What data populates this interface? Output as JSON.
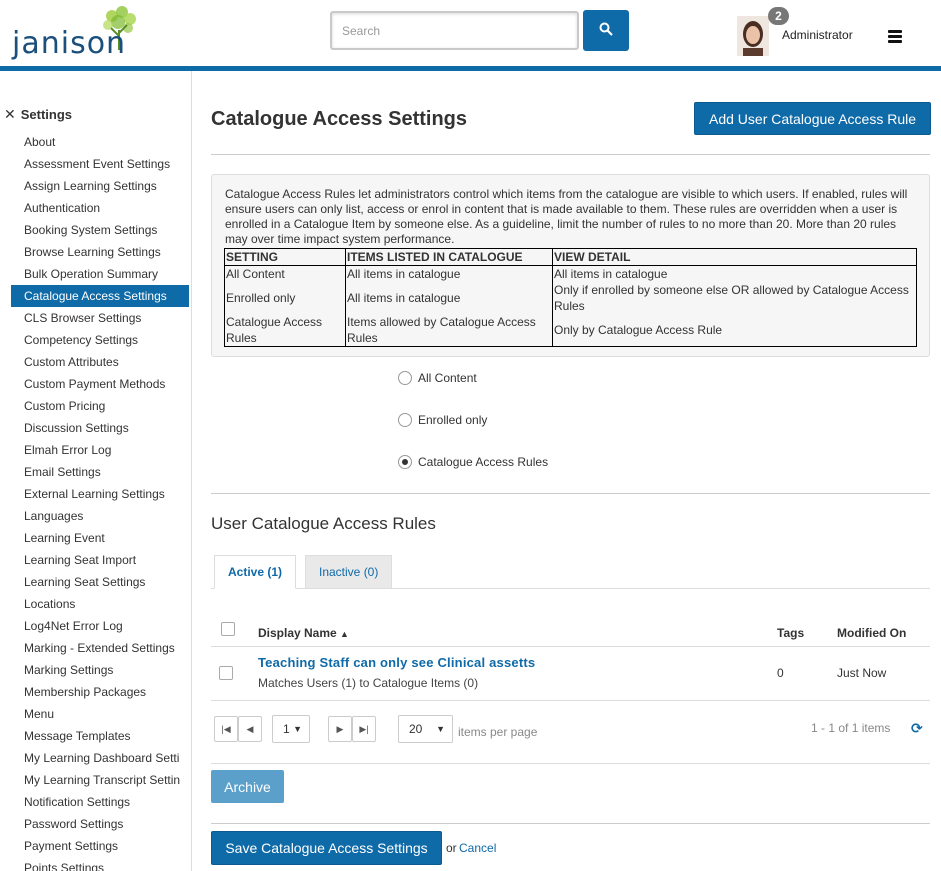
{
  "header": {
    "logo_text": "janison",
    "search_placeholder": "Search",
    "notification_count": "2",
    "user_name": "Administrator"
  },
  "colors": {
    "brand": "#0f6aa8",
    "archive": "#5b9fcb"
  },
  "sidebar": {
    "title": "Settings",
    "items": [
      "About",
      "Assessment Event Settings",
      "Assign Learning Settings",
      "Authentication",
      "Booking System Settings",
      "Browse Learning Settings",
      "Bulk Operation Summary",
      "Catalogue Access Settings",
      "CLS Browser Settings",
      "Competency Settings",
      "Custom Attributes",
      "Custom Payment Methods",
      "Custom Pricing",
      "Discussion Settings",
      "Elmah Error Log",
      "Email Settings",
      "External Learning Settings",
      "Languages",
      "Learning Event",
      "Learning Seat Import",
      "Learning Seat Settings",
      "Locations",
      "Log4Net Error Log",
      "Marking - Extended Settings",
      "Marking Settings",
      "Membership Packages",
      "Menu",
      "Message Templates",
      "My Learning Dashboard Setti",
      "My Learning Transcript Settin",
      "Notification Settings",
      "Password Settings",
      "Payment Settings",
      "Points Settings"
    ],
    "active_index": 7
  },
  "main": {
    "title": "Catalogue Access Settings",
    "add_rule_label": "Add User Catalogue Access Rule",
    "info_text": "Catalogue Access Rules let administrators control which items from the catalogue are visible to which users. If enabled, rules will ensure users can only list, access or enrol in content that is made available to them. These rules are overridden when a user is enrolled in a Catalogue Item by someone else. As a guideline, limit the number of rules to no more than 20. More than 20 rules may over time impact system performance.",
    "table": {
      "headers": [
        "SETTING",
        "ITEMS LISTED IN CATALOGUE",
        "VIEW DETAIL"
      ],
      "rows": [
        [
          "All Content",
          "All items in catalogue",
          "All items in catalogue"
        ],
        [
          "Enrolled only",
          "All items in catalogue",
          "Only if enrolled by someone else OR allowed by Catalogue Access Rules"
        ],
        [
          "Catalogue Access Rules",
          "Items allowed by Catalogue Access Rules",
          "Only by Catalogue Access Rule"
        ]
      ]
    },
    "options": [
      "All Content",
      "Enrolled only",
      "Catalogue Access Rules"
    ],
    "selected_option": "Catalogue Access Rules",
    "rules_section_title": "User Catalogue Access Rules",
    "tabs": {
      "active": "Active (1)",
      "inactive": "Inactive (0)"
    },
    "grid": {
      "col_name": "Display Name",
      "sort_indicator": "▲",
      "col_tags": "Tags",
      "col_modified": "Modified On",
      "row": {
        "name": "Teaching Staff can only see Clinical assetts",
        "subtitle": "Matches Users (1) to Catalogue Items (0)",
        "tags": "0",
        "modified": "Just Now"
      }
    },
    "pager": {
      "page": "1",
      "page_size": "20",
      "per_page_label": "items per page",
      "info": "1 - 1 of 1 items"
    },
    "archive_label": "Archive",
    "save_label": "Save Catalogue Access Settings",
    "or_text": "or",
    "cancel_label": "Cancel"
  }
}
